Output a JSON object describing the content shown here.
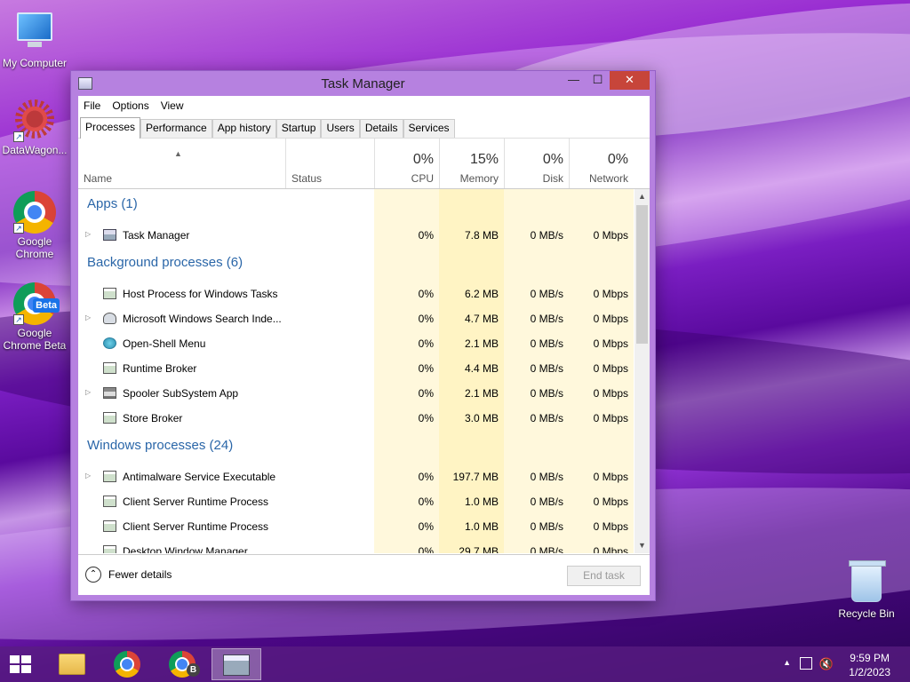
{
  "desktop": {
    "icons": [
      {
        "label": "My Computer"
      },
      {
        "label": "DataWagon..."
      },
      {
        "label": "Google Chrome"
      },
      {
        "label": "Google Chrome Beta",
        "badge": "Beta"
      },
      {
        "label": "Recycle Bin"
      }
    ]
  },
  "window": {
    "title": "Task Manager",
    "buttons": {
      "minimize": "—",
      "maximize": "☐",
      "close": "✕"
    },
    "menu": [
      "File",
      "Options",
      "View"
    ],
    "tabs": [
      "Processes",
      "Performance",
      "App history",
      "Startup",
      "Users",
      "Details",
      "Services"
    ],
    "active_tab": "Processes",
    "columns": {
      "name": "Name",
      "status": "Status",
      "cpu": {
        "pct": "0%",
        "label": "CPU"
      },
      "memory": {
        "pct": "15%",
        "label": "Memory"
      },
      "disk": {
        "pct": "0%",
        "label": "Disk"
      },
      "network": {
        "pct": "0%",
        "label": "Network"
      }
    },
    "groups": {
      "apps": "Apps (1)",
      "background": "Background processes (6)",
      "windows": "Windows processes (24)"
    },
    "rows": [
      {
        "name": "Task Manager",
        "cpu": "0%",
        "memory": "7.8 MB",
        "disk": "0 MB/s",
        "network": "0 Mbps"
      },
      {
        "name": "Host Process for Windows Tasks",
        "cpu": "0%",
        "memory": "6.2 MB",
        "disk": "0 MB/s",
        "network": "0 Mbps"
      },
      {
        "name": "Microsoft Windows Search Inde...",
        "cpu": "0%",
        "memory": "4.7 MB",
        "disk": "0 MB/s",
        "network": "0 Mbps"
      },
      {
        "name": "Open-Shell Menu",
        "cpu": "0%",
        "memory": "2.1 MB",
        "disk": "0 MB/s",
        "network": "0 Mbps"
      },
      {
        "name": "Runtime Broker",
        "cpu": "0%",
        "memory": "4.4 MB",
        "disk": "0 MB/s",
        "network": "0 Mbps"
      },
      {
        "name": "Spooler SubSystem App",
        "cpu": "0%",
        "memory": "2.1 MB",
        "disk": "0 MB/s",
        "network": "0 Mbps"
      },
      {
        "name": "Store Broker",
        "cpu": "0%",
        "memory": "3.0 MB",
        "disk": "0 MB/s",
        "network": "0 Mbps"
      },
      {
        "name": "Antimalware Service Executable",
        "cpu": "0%",
        "memory": "197.7 MB",
        "disk": "0 MB/s",
        "network": "0 Mbps"
      },
      {
        "name": "Client Server Runtime Process",
        "cpu": "0%",
        "memory": "1.0 MB",
        "disk": "0 MB/s",
        "network": "0 Mbps"
      },
      {
        "name": "Client Server Runtime Process",
        "cpu": "0%",
        "memory": "1.0 MB",
        "disk": "0 MB/s",
        "network": "0 Mbps"
      },
      {
        "name": "Desktop Window Manager",
        "cpu": "0%",
        "memory": "29.7 MB",
        "disk": "0 MB/s",
        "network": "0 Mbps"
      }
    ],
    "footer": {
      "fewer_details": "Fewer details",
      "end_task": "End task"
    }
  },
  "taskbar": {
    "clock_time": "9:59 PM",
    "clock_date": "1/2/2023",
    "chrome_beta_badge": "B"
  },
  "colors": {
    "group_header": "#2a66a8",
    "accent_window": "#b681e0",
    "close_button": "#c7453a"
  }
}
